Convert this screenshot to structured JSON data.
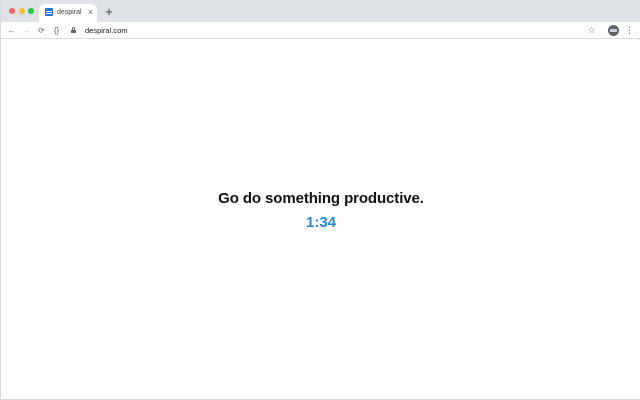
{
  "browser": {
    "tab": {
      "title": "despiral",
      "close": "×"
    },
    "new_tab": "+",
    "nav": {
      "back": "←",
      "forward": "→",
      "reload": "⟳",
      "extensions": "{}"
    },
    "url": "despiral.com",
    "bookmark_star": "☆",
    "menu": "⋮"
  },
  "page": {
    "message": "Go do something productive.",
    "timer": "1:34"
  },
  "colors": {
    "timer": "#1e88d0",
    "favicon": "#1a73e8"
  }
}
